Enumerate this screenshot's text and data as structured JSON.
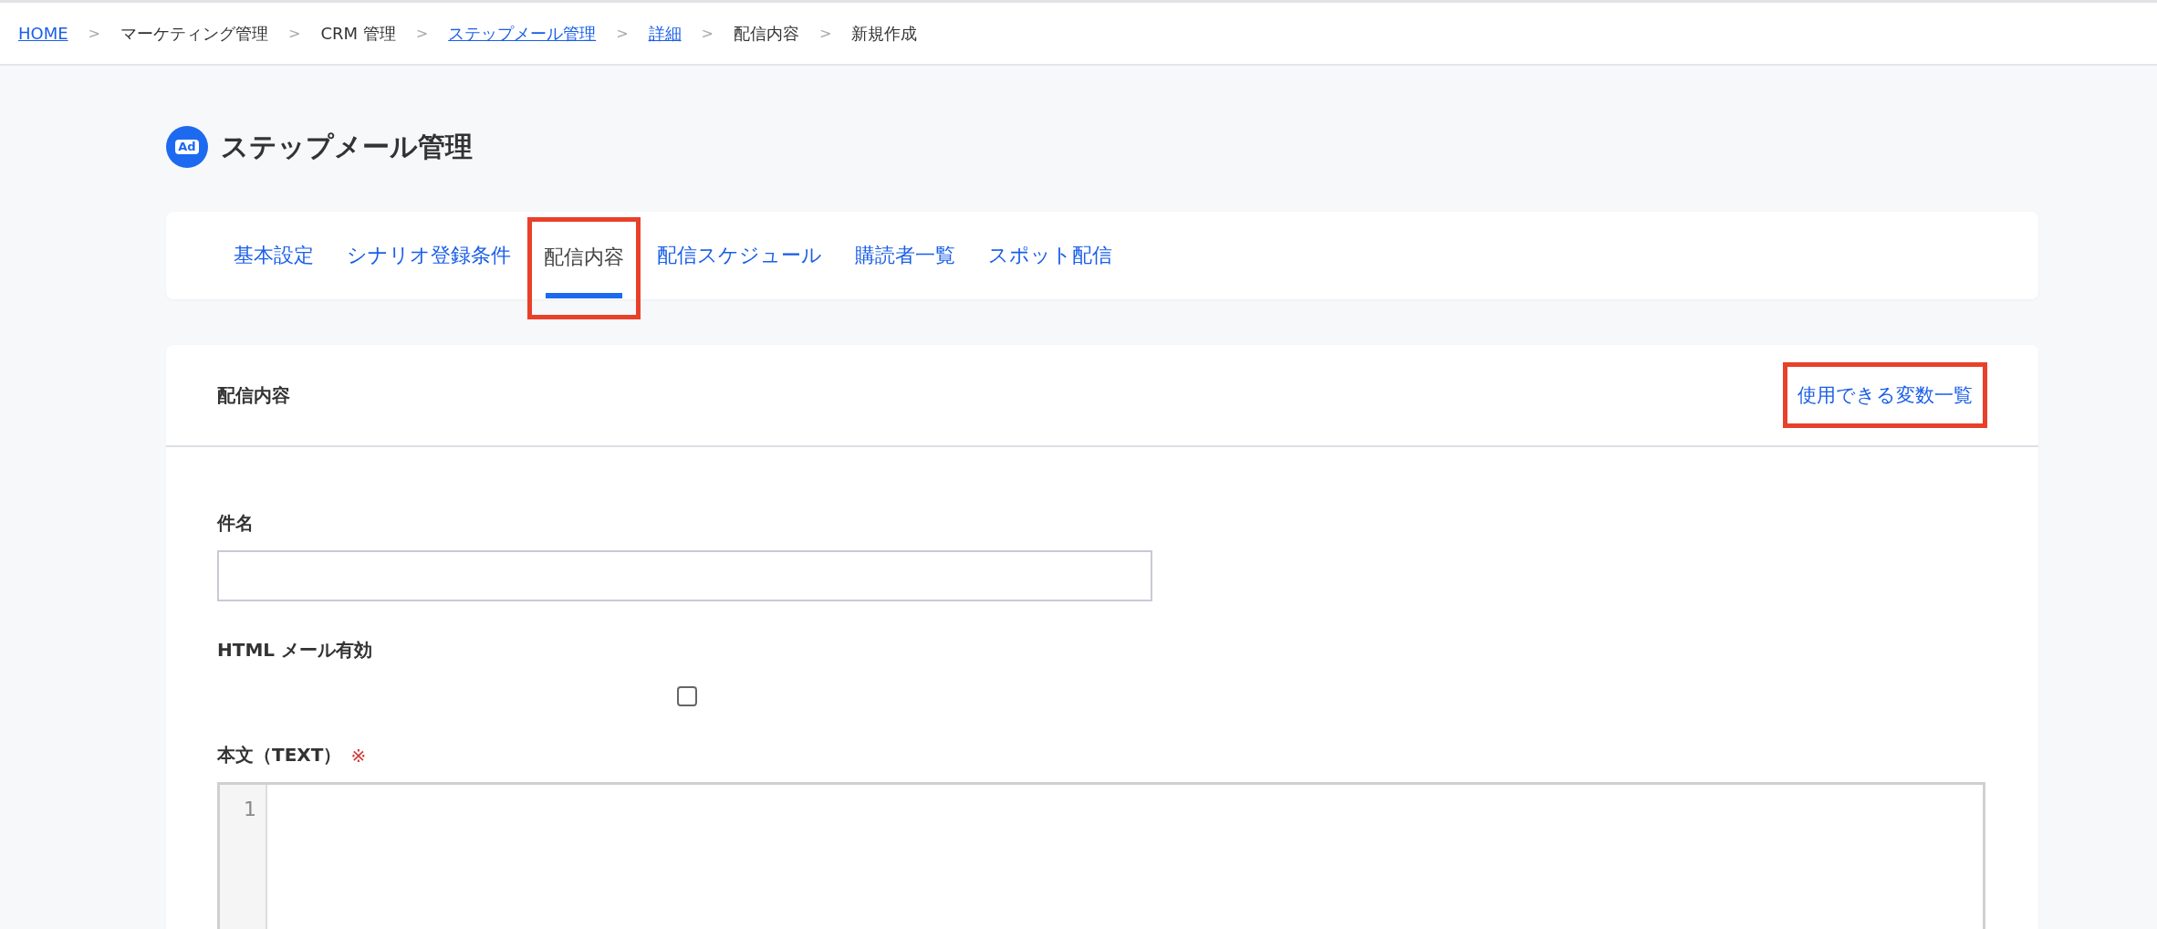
{
  "breadcrumb": [
    {
      "label": "HOME",
      "link": true
    },
    {
      "label": "マーケティング管理",
      "link": false
    },
    {
      "label": "CRM 管理",
      "link": false
    },
    {
      "label": "ステップメール管理",
      "link": true
    },
    {
      "label": "詳細",
      "link": true
    },
    {
      "label": "配信内容",
      "link": false
    },
    {
      "label": "新規作成",
      "link": false
    }
  ],
  "breadcrumb_separator": ">",
  "page_title": {
    "icon_text": "Ad",
    "title": "ステップメール管理"
  },
  "tabs": [
    {
      "label": "基本設定",
      "selected": false,
      "highlighted": false
    },
    {
      "label": "シナリオ登録条件",
      "selected": false,
      "highlighted": false
    },
    {
      "label": "配信内容",
      "selected": true,
      "highlighted": true
    },
    {
      "label": "配信スケジュール",
      "selected": false,
      "highlighted": false
    },
    {
      "label": "購読者一覧",
      "selected": false,
      "highlighted": false
    },
    {
      "label": "スポット配信",
      "selected": false,
      "highlighted": false
    }
  ],
  "card": {
    "title": "配信内容",
    "link": {
      "label": "使用できる変数一覧",
      "highlighted": true
    },
    "fields": [
      {
        "kind": "text",
        "label": "件名"
      },
      {
        "kind": "checkbox",
        "label": "HTML メール有効",
        "checked": false
      },
      {
        "kind": "code",
        "label": "本文（TEXT）",
        "required_mark": "※",
        "line_numbers": [
          "1"
        ]
      }
    ]
  }
}
